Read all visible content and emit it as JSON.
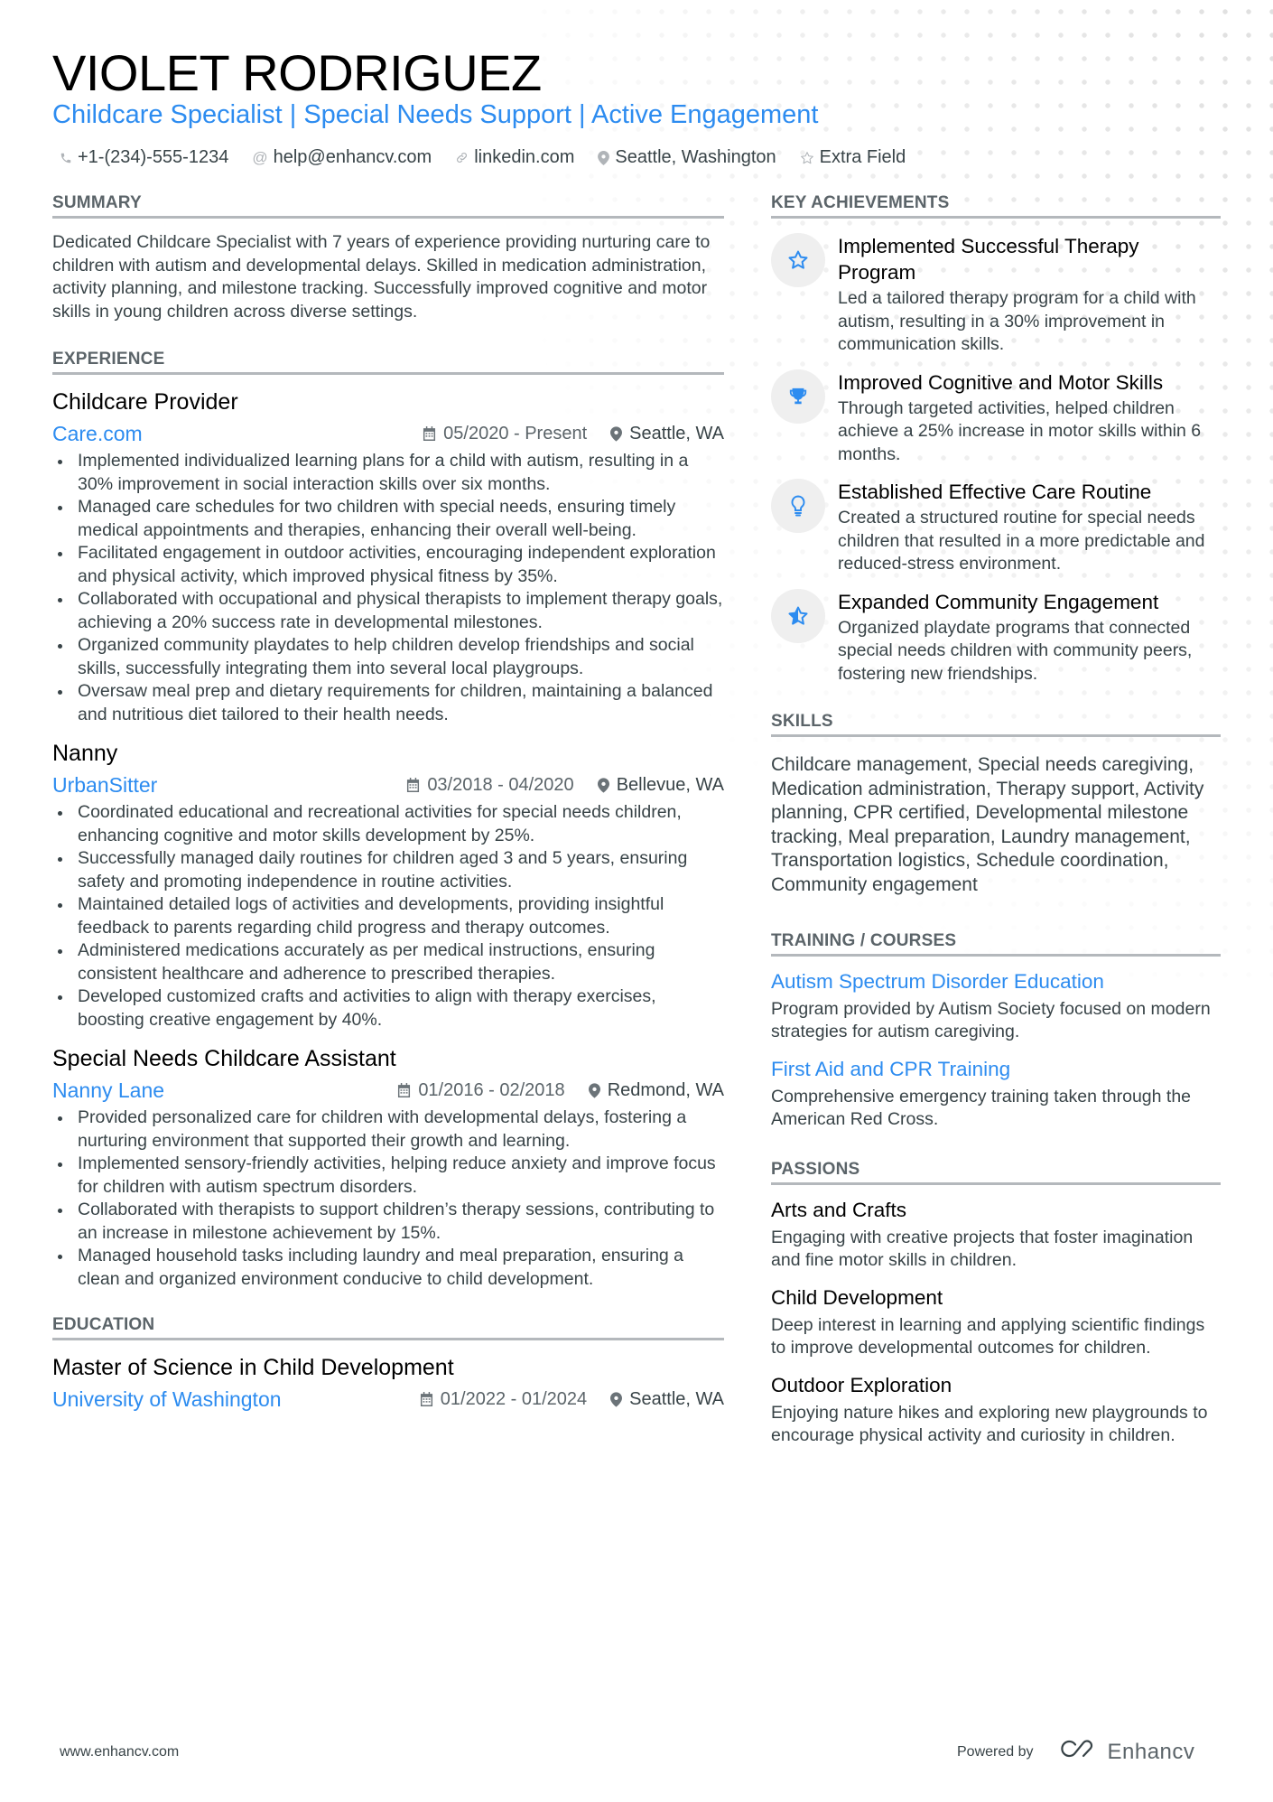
{
  "header": {
    "name": "VIOLET RODRIGUEZ",
    "tagline": "Childcare Specialist | Special Needs Support | Active Engagement",
    "contacts": [
      {
        "icon": "phone-icon",
        "text": "+1-(234)-555-1234"
      },
      {
        "icon": "at-icon",
        "text": "help@enhancv.com"
      },
      {
        "icon": "link-icon",
        "text": "linkedin.com"
      },
      {
        "icon": "location-icon",
        "text": "Seattle, Washington"
      },
      {
        "icon": "star-icon",
        "text": "Extra Field"
      }
    ]
  },
  "summary": {
    "title": "SUMMARY",
    "text": "Dedicated Childcare Specialist with 7 years of experience providing nurturing care to children with autism and developmental delays. Skilled in medication administration, activity planning, and milestone tracking. Successfully improved cognitive and motor skills in young children across diverse settings."
  },
  "experience": {
    "title": "EXPERIENCE",
    "jobs": [
      {
        "role": "Childcare Provider",
        "company": "Care.com",
        "dates": "05/2020 - Present",
        "location": "Seattle, WA",
        "bullets": [
          "Implemented individualized learning plans for a child with autism, resulting in a 30% improvement in social interaction skills over six months.",
          "Managed care schedules for two children with special needs, ensuring timely medical appointments and therapies, enhancing their overall well-being.",
          "Facilitated engagement in outdoor activities, encouraging independent exploration and physical activity, which improved physical fitness by 35%.",
          "Collaborated with occupational and physical therapists to implement therapy goals, achieving a 20% success rate in developmental milestones.",
          "Organized community playdates to help children develop friendships and social skills, successfully integrating them into several local playgroups.",
          "Oversaw meal prep and dietary requirements for children, maintaining a balanced and nutritious diet tailored to their health needs."
        ]
      },
      {
        "role": "Nanny",
        "company": "UrbanSitter",
        "dates": "03/2018 - 04/2020",
        "location": "Bellevue, WA",
        "bullets": [
          "Coordinated educational and recreational activities for special needs children, enhancing cognitive and motor skills development by 25%.",
          "Successfully managed daily routines for children aged 3 and 5 years, ensuring safety and promoting independence in routine activities.",
          "Maintained detailed logs of activities and developments, providing insightful feedback to parents regarding child progress and therapy outcomes.",
          "Administered medications accurately as per medical instructions, ensuring consistent healthcare and adherence to prescribed therapies.",
          "Developed customized crafts and activities to align with therapy exercises, boosting creative engagement by 40%."
        ]
      },
      {
        "role": "Special Needs Childcare Assistant",
        "company": "Nanny Lane",
        "dates": "01/2016 - 02/2018",
        "location": "Redmond, WA",
        "bullets": [
          "Provided personalized care for children with developmental delays, fostering a nurturing environment that supported their growth and learning.",
          "Implemented sensory-friendly activities, helping reduce anxiety and improve focus for children with autism spectrum disorders.",
          "Collaborated with therapists to support children’s therapy sessions, contributing to an increase in milestone achievement by 15%.",
          "Managed household tasks including laundry and meal preparation, ensuring a clean and organized environment conducive to child development."
        ]
      }
    ]
  },
  "education": {
    "title": "EDUCATION",
    "items": [
      {
        "degree": "Master of Science in Child Development",
        "school": "University of Washington",
        "dates": "01/2022 - 01/2024",
        "location": "Seattle, WA"
      }
    ]
  },
  "achievements": {
    "title": "KEY ACHIEVEMENTS",
    "items": [
      {
        "icon": "star-outline-icon",
        "title": "Implemented Successful Therapy Program",
        "desc": "Led a tailored therapy program for a child with autism, resulting in a 30% improvement in communication skills."
      },
      {
        "icon": "trophy-icon",
        "title": "Improved Cognitive and Motor Skills",
        "desc": "Through targeted activities, helped children achieve a 25% increase in motor skills within 6 months."
      },
      {
        "icon": "lightbulb-icon",
        "title": "Established Effective Care Routine",
        "desc": "Created a structured routine for special needs children that resulted in a more predictable and reduced-stress environment."
      },
      {
        "icon": "star-half-icon",
        "title": "Expanded Community Engagement",
        "desc": "Organized playdate programs that connected special needs children with community peers, fostering new friendships."
      }
    ]
  },
  "skills": {
    "title": "SKILLS",
    "text": "Childcare management, Special needs caregiving, Medication administration, Therapy support, Activity planning, CPR certified, Developmental milestone tracking, Meal preparation, Laundry management, Transportation logistics, Schedule coordination, Community engagement"
  },
  "training": {
    "title": "TRAINING / COURSES",
    "items": [
      {
        "title": "Autism Spectrum Disorder Education",
        "desc": "Program provided by Autism Society focused on modern strategies for autism caregiving."
      },
      {
        "title": "First Aid and CPR Training",
        "desc": "Comprehensive emergency training taken through the American Red Cross."
      }
    ]
  },
  "passions": {
    "title": "PASSIONS",
    "items": [
      {
        "title": "Arts and Crafts",
        "desc": "Engaging with creative projects that foster imagination and fine motor skills in children."
      },
      {
        "title": "Child Development",
        "desc": "Deep interest in learning and applying scientific findings to improve developmental outcomes for children."
      },
      {
        "title": "Outdoor Exploration",
        "desc": "Enjoying nature hikes and exploring new playgrounds to encourage physical activity and curiosity in children."
      }
    ]
  },
  "footer": {
    "website": "www.enhancv.com",
    "powered_by": "Powered by",
    "brand": "Enhancv"
  },
  "colors": {
    "accent": "#2d8cf0",
    "text": "#384347",
    "heading": "#000000",
    "section_rule": "#b4b8bc",
    "icon_circle": "#efefef"
  }
}
